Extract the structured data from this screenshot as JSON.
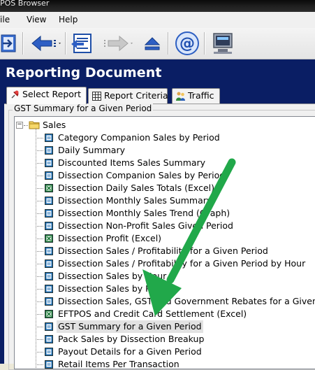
{
  "window": {
    "title": "POS Browser"
  },
  "menu": [
    {
      "label": "File",
      "underline": "F"
    },
    {
      "label": "View",
      "underline": "V"
    },
    {
      "label": "Help",
      "underline": "H"
    }
  ],
  "toolbar": {
    "icons": [
      "exit-icon",
      "back-arrow-icon",
      "dropdown-arrow-icon",
      "import-icon",
      "forward-arrow-icon",
      "dropdown-arrow-icon",
      "eject-icon",
      "email-icon",
      "monitor-icon"
    ]
  },
  "header": {
    "title": "Reporting Document"
  },
  "tabs": [
    {
      "label": "Select Report",
      "underline": "S",
      "icon": "pin-icon",
      "active": true
    },
    {
      "label": "Report Criteria",
      "underline": "R",
      "icon": "table-icon",
      "active": false
    },
    {
      "label": "Traffic",
      "underline": "T",
      "icon": "people-icon",
      "active": false
    }
  ],
  "group": {
    "label": "GST Summary for a Given Period"
  },
  "tree": {
    "root": {
      "label": "Sales",
      "expander": "−",
      "icon": "folder-icon"
    },
    "items": [
      {
        "label": "Category Companion Sales by Period",
        "icon": "report-icon"
      },
      {
        "label": "Daily Summary",
        "icon": "report-icon"
      },
      {
        "label": "Discounted Items Sales Summary",
        "icon": "report-icon"
      },
      {
        "label": "Dissection Companion Sales by Period",
        "icon": "report-icon"
      },
      {
        "label": "Dissection Daily Sales Totals (Excel)",
        "icon": "excel-icon"
      },
      {
        "label": "Dissection Monthly Sales Summary",
        "icon": "report-icon"
      },
      {
        "label": "Dissection Monthly Sales Trend (Graph)",
        "icon": "report-icon"
      },
      {
        "label": "Dissection Non-Profit Sales Given Period",
        "icon": "report-icon"
      },
      {
        "label": "Dissection Profit (Excel)",
        "icon": "excel-icon"
      },
      {
        "label": "Dissection Sales / Profitability for a Given Period",
        "icon": "report-icon"
      },
      {
        "label": "Dissection Sales / Profitability for a Given Period by Hour",
        "icon": "report-icon"
      },
      {
        "label": "Dissection Sales by Hour",
        "icon": "report-icon"
      },
      {
        "label": "Dissection Sales by Post",
        "icon": "report-icon"
      },
      {
        "label": "Dissection Sales, GST and Government Rebates for a Given Period",
        "icon": "report-icon"
      },
      {
        "label": "EFTPOS and Credit Card Settlement (Excel)",
        "icon": "excel-icon"
      },
      {
        "label": "GST Summary for a Given Period",
        "icon": "report-icon",
        "selected": true
      },
      {
        "label": "Pack Sales by Dissection Breakup",
        "icon": "report-icon"
      },
      {
        "label": "Payout Details for a Given Period",
        "icon": "report-icon"
      },
      {
        "label": "Retail Items Per Transaction",
        "icon": "report-icon"
      }
    ]
  },
  "colors": {
    "header_bg": "#0a1e64",
    "annotation_arrow": "#21a84a",
    "report_icon": "#1f6fb5",
    "excel_icon": "#1e7b3a",
    "folder": "#f0c43c"
  }
}
